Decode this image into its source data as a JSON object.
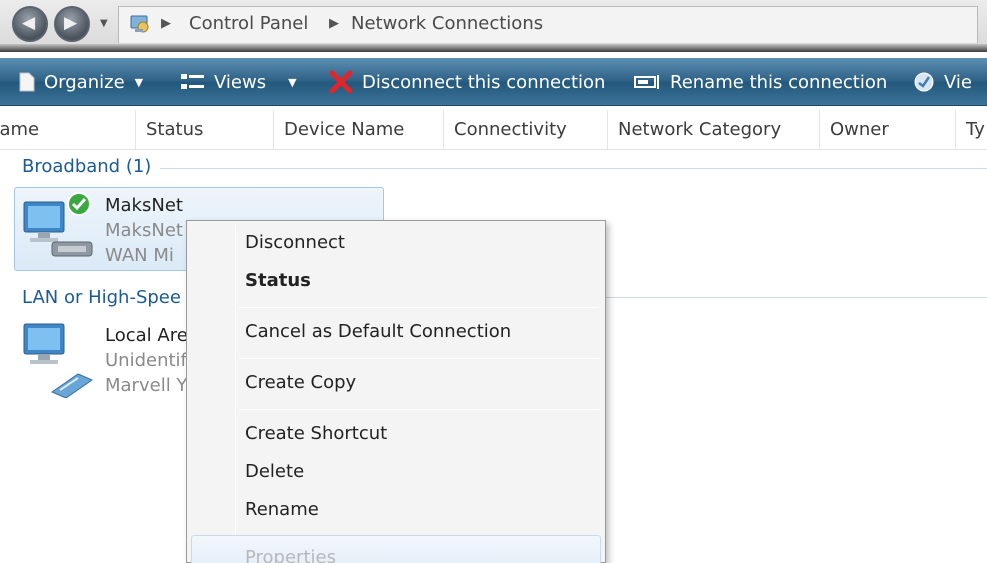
{
  "address": {
    "breadcrumbs": [
      "Control Panel",
      "Network Connections"
    ],
    "icons": [
      "back-icon",
      "forward-icon",
      "control-panel-icon"
    ]
  },
  "toolbar": {
    "organize": "Organize",
    "views": "Views",
    "disconnect": "Disconnect this connection",
    "rename": "Rename this connection",
    "view_partial": "Vie",
    "icons": [
      "organize-icon",
      "views-icon",
      "red-x-icon",
      "rename-icon",
      "view-status-icon"
    ]
  },
  "columns": [
    "Name",
    "Status",
    "Device Name",
    "Connectivity",
    "Network Category",
    "Owner",
    "Ty"
  ],
  "groups": {
    "broadband": "Broadband (1)",
    "lan": "LAN or High-Spee"
  },
  "items": [
    {
      "name": "MaksNet",
      "line2": "MaksNet",
      "line3": "WAN Mi",
      "icon": "broadband-connection-icon",
      "status_icon": "check-icon"
    },
    {
      "name": "Local Are",
      "line2": "Unidentif",
      "line3": "Marvell Y",
      "icon": "lan-connection-icon"
    }
  ],
  "context_menu": {
    "items": [
      {
        "label": "Disconnect"
      },
      {
        "label": "Status",
        "bold": true
      },
      {
        "label": "Cancel as Default Connection"
      },
      {
        "label": "Create Copy"
      },
      {
        "label": "Create Shortcut"
      },
      {
        "label": "Delete"
      },
      {
        "label": "Rename"
      },
      {
        "label": "Properties",
        "disabled": true
      }
    ]
  },
  "colors": {
    "toolbar": "#2f6287",
    "group_title": "#1d5a93",
    "selection": "#dbeaf7"
  }
}
